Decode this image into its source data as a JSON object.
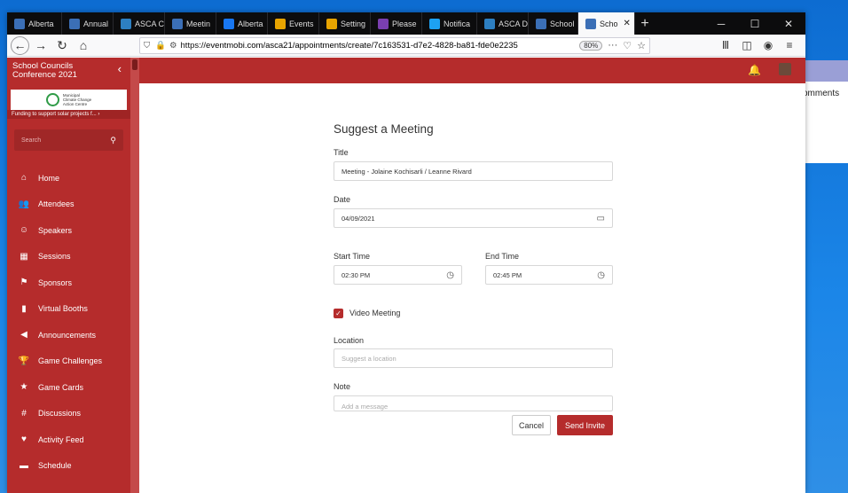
{
  "browser": {
    "tabs": [
      {
        "label": "Alberta",
        "color": "#3b6fb6",
        "icon": "tab-icon"
      },
      {
        "label": "Annual",
        "color": "#3b6fb6",
        "icon": "tab-icon"
      },
      {
        "label": "ASCA C",
        "color": "#2d7fc1",
        "icon": "tab-icon"
      },
      {
        "label": "Meetin",
        "color": "#3b6fb6",
        "icon": "tab-icon"
      },
      {
        "label": "Alberta",
        "color": "#1877f2",
        "icon": "facebook-icon"
      },
      {
        "label": "Events",
        "color": "#e8a400",
        "icon": "sigma-icon"
      },
      {
        "label": "Setting",
        "color": "#e8a400",
        "icon": "sigma-icon"
      },
      {
        "label": "Please",
        "color": "#7a3fb0",
        "icon": "tab-icon"
      },
      {
        "label": "Notifica",
        "color": "#1da1f2",
        "icon": "twitter-icon"
      },
      {
        "label": "ASCA D",
        "color": "#2d7fc1",
        "icon": "tab-icon"
      },
      {
        "label": "School",
        "color": "#3b6fb6",
        "icon": "tab-icon"
      },
      {
        "label": "Scho",
        "color": "#3b6fb6",
        "icon": "tab-icon",
        "active": true
      }
    ],
    "url_prefix": "https://",
    "url_main": "eventmobi.com/asca21/appointments/create/7c163531-d7e2-4828-ba81-fde0e2235",
    "zoom": "80%"
  },
  "background_window": {
    "text": "omments"
  },
  "sidebar": {
    "title_line1": "School Councils",
    "title_line2": "Conference 2021",
    "logo_text_1": "Municipal",
    "logo_text_2": "Climate Change",
    "logo_text_3": "Action Centre",
    "promo": "Funding to support solar projects f... ›",
    "search_placeholder": "Search",
    "items": [
      {
        "label": "Home",
        "icon": "home-icon",
        "glyph": "⌂"
      },
      {
        "label": "Attendees",
        "icon": "attendees-icon",
        "glyph": "👥"
      },
      {
        "label": "Speakers",
        "icon": "speaker-icon",
        "glyph": "☺"
      },
      {
        "label": "Sessions",
        "icon": "sessions-icon",
        "glyph": "▦"
      },
      {
        "label": "Sponsors",
        "icon": "flag-icon",
        "glyph": "⚑"
      },
      {
        "label": "Virtual Booths",
        "icon": "bookmark-icon",
        "glyph": "▮"
      },
      {
        "label": "Announcements",
        "icon": "megaphone-icon",
        "glyph": "◀"
      },
      {
        "label": "Game Challenges",
        "icon": "trophy-icon",
        "glyph": "🏆"
      },
      {
        "label": "Game Cards",
        "icon": "star-icon",
        "glyph": "★"
      },
      {
        "label": "Discussions",
        "icon": "hashtag-icon",
        "glyph": "#"
      },
      {
        "label": "Activity Feed",
        "icon": "heart-icon",
        "glyph": "♥"
      },
      {
        "label": "Schedule",
        "icon": "folder-icon",
        "glyph": "▬"
      }
    ]
  },
  "form": {
    "heading": "Suggest a Meeting",
    "title_label": "Title",
    "title_value": "Meeting - Jolaine Kochisarli / Leanne Rivard",
    "date_label": "Date",
    "date_value": "04/09/2021",
    "start_label": "Start Time",
    "start_value": "02:30 PM",
    "end_label": "End Time",
    "end_value": "02:45 PM",
    "video_label": "Video Meeting",
    "video_checked": true,
    "location_label": "Location",
    "location_placeholder": "Suggest a location",
    "note_label": "Note",
    "note_placeholder": "Add a message",
    "cancel_label": "Cancel",
    "send_label": "Send Invite"
  },
  "colors": {
    "brand": "#b52c2c",
    "brand_dark": "#a02727"
  }
}
